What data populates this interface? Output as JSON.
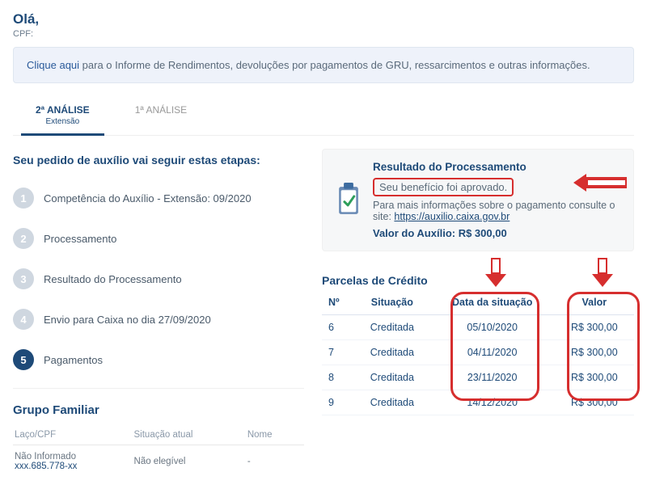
{
  "header": {
    "greeting": "Olá,",
    "cpf_label": "CPF:"
  },
  "infobar": {
    "link_text": "Clique aqui",
    "text": " para o Informe de Rendimentos, devoluções por pagamentos de GRU, ressarcimentos e outras informações."
  },
  "tabs": {
    "active": {
      "label": "2ª ANÁLISE",
      "sub": "Extensão"
    },
    "inactive": {
      "label": "1ª ANÁLISE"
    }
  },
  "steps": {
    "title": "Seu pedido de auxílio vai seguir estas etapas:",
    "items": [
      {
        "n": "1",
        "label": "Competência do Auxílio - Extensão: 09/2020"
      },
      {
        "n": "2",
        "label": "Processamento"
      },
      {
        "n": "3",
        "label": "Resultado do Processamento"
      },
      {
        "n": "4",
        "label": "Envio para Caixa no dia 27/09/2020"
      },
      {
        "n": "5",
        "label": "Pagamentos"
      }
    ]
  },
  "grupo": {
    "title": "Grupo Familiar",
    "head": {
      "laco": "Laço/CPF",
      "situ": "Situação atual",
      "nome": "Nome"
    },
    "row": {
      "laco1": "Não Informado",
      "laco2": "xxx.685.778-xx",
      "situ": "Não elegível",
      "nome": "-"
    }
  },
  "resultado": {
    "title": "Resultado do Processamento",
    "approved": "Seu benefício foi aprovado.",
    "info_prefix": "Para mais informações sobre o pagamento consulte o site: ",
    "info_link": "https://auxilio.caixa.gov.br",
    "valor_label": "Valor do Auxílio: ",
    "valor": "R$ 300,00"
  },
  "parcelas": {
    "title": "Parcelas de Crédito",
    "head": {
      "n": "Nº",
      "s": "Situação",
      "d": "Data da situação",
      "v": "Valor"
    },
    "rows": [
      {
        "n": "6",
        "s": "Creditada",
        "d": "05/10/2020",
        "v": "R$ 300,00"
      },
      {
        "n": "7",
        "s": "Creditada",
        "d": "04/11/2020",
        "v": "R$ 300,00"
      },
      {
        "n": "8",
        "s": "Creditada",
        "d": "23/11/2020",
        "v": "R$ 300,00"
      },
      {
        "n": "9",
        "s": "Creditada",
        "d": "14/12/2020",
        "v": "R$ 300,00"
      }
    ]
  }
}
